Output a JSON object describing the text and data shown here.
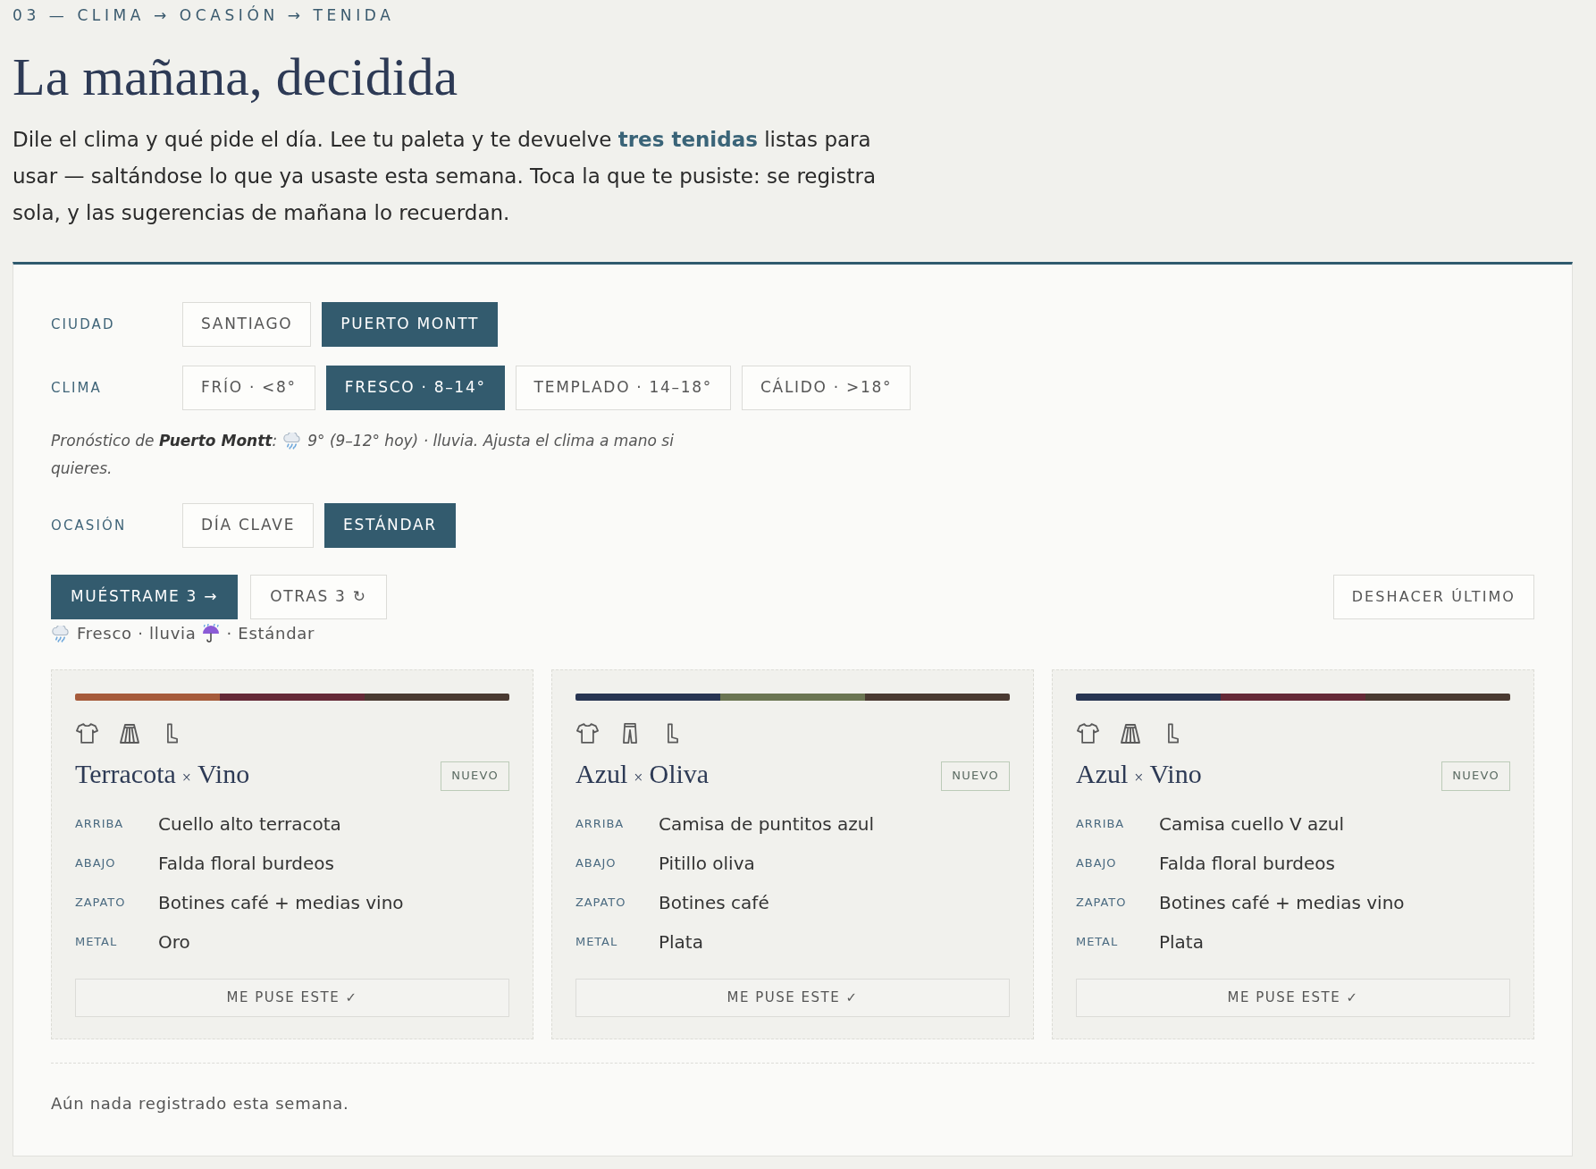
{
  "eyebrow": "03 — CLIMA → OCASIÓN → TENIDA",
  "title": "La mañana, decidida",
  "intro": "Dile el clima y qué pide el día. Lee tu paleta y te devuelve **tres tenidas** listas para usar — saltándose lo que ya usaste esta semana. Toca la que te pusiste: se registra sola, y las sugerencias de mañana lo recuerdan.",
  "rows": [
    {
      "kind": "choice",
      "label": "CIUDAD",
      "options": [
        {
          "label": "SANTIAGO",
          "selected": false
        },
        {
          "label": "PUERTO MONTT",
          "selected": true
        }
      ]
    },
    {
      "kind": "choice",
      "label": "CLIMA",
      "options": [
        {
          "label": "FRÍO · <8°",
          "selected": false
        },
        {
          "label": "FRESCO · 8–14°",
          "selected": true
        },
        {
          "label": "TEMPLADO · 14–18°",
          "selected": false
        },
        {
          "label": "CÁLIDO · >18°",
          "selected": false
        }
      ]
    },
    {
      "kind": "note",
      "prefix": "Pronóstico de **Puerto Montt**:",
      "lines": [
        "9° (9–12° hoy) · lluvia. Ajusta el clima a mano si",
        "quieres."
      ]
    },
    {
      "kind": "choice",
      "label": "OCASIÓN",
      "options": [
        {
          "label": "DÍA CLAVE",
          "selected": false
        },
        {
          "label": "ESTÁNDAR",
          "selected": true
        }
      ]
    }
  ],
  "actions": [
    {
      "kind": "primary",
      "label": "MUÉSTRAME 3 →"
    },
    {
      "kind": "secondary",
      "label": "OTRAS 3 ↻"
    }
  ],
  "undo_button": "DESHACER ÚLTIMO",
  "summary": {
    "weather": "Fresco · lluvia",
    "occasion": "· Estándar"
  },
  "outfits": [
    {
      "palette": [
        {
          "color": "#a65b3b"
        },
        {
          "color": "#652a37"
        },
        {
          "color": "#4a3a31"
        }
      ],
      "garments": [
        {
          "kind": "shirt"
        },
        {
          "kind": "skirt"
        },
        {
          "kind": "boot"
        }
      ],
      "title": [
        "Terracota",
        "×",
        "Vino"
      ],
      "badge": "NUEVO",
      "rows": [
        {
          "label": "ARRIBA",
          "value": "Cuello alto terracota"
        },
        {
          "label": "ABAJO",
          "value": "Falda floral burdeos"
        },
        {
          "label": "ZAPATO",
          "value": "Botines café + medias vino"
        },
        {
          "label": "METAL",
          "value": "Oro"
        }
      ],
      "button": "ME PUSE ESTE ✓"
    },
    {
      "palette": [
        {
          "color": "#283552"
        },
        {
          "color": "#6b7552"
        },
        {
          "color": "#4a3a31"
        }
      ],
      "garments": [
        {
          "kind": "shirt"
        },
        {
          "kind": "trousers"
        },
        {
          "kind": "boot"
        }
      ],
      "title": [
        "Azul",
        "×",
        "Oliva"
      ],
      "badge": "NUEVO",
      "rows": [
        {
          "label": "ARRIBA",
          "value": "Camisa de puntitos azul"
        },
        {
          "label": "ABAJO",
          "value": "Pitillo oliva"
        },
        {
          "label": "ZAPATO",
          "value": "Botines café"
        },
        {
          "label": "METAL",
          "value": "Plata"
        }
      ],
      "button": "ME PUSE ESTE ✓"
    },
    {
      "palette": [
        {
          "color": "#283552"
        },
        {
          "color": "#652a37"
        },
        {
          "color": "#4a3a31"
        }
      ],
      "garments": [
        {
          "kind": "shirt"
        },
        {
          "kind": "skirt"
        },
        {
          "kind": "boot"
        }
      ],
      "title": [
        "Azul",
        "×",
        "Vino"
      ],
      "badge": "NUEVO",
      "rows": [
        {
          "label": "ARRIBA",
          "value": "Camisa cuello V azul"
        },
        {
          "label": "ABAJO",
          "value": "Falda floral burdeos"
        },
        {
          "label": "ZAPATO",
          "value": "Botines café + medias vino"
        },
        {
          "label": "METAL",
          "value": "Plata"
        }
      ],
      "button": "ME PUSE ESTE ✓"
    }
  ],
  "log": "Aún nada registrado esta semana."
}
